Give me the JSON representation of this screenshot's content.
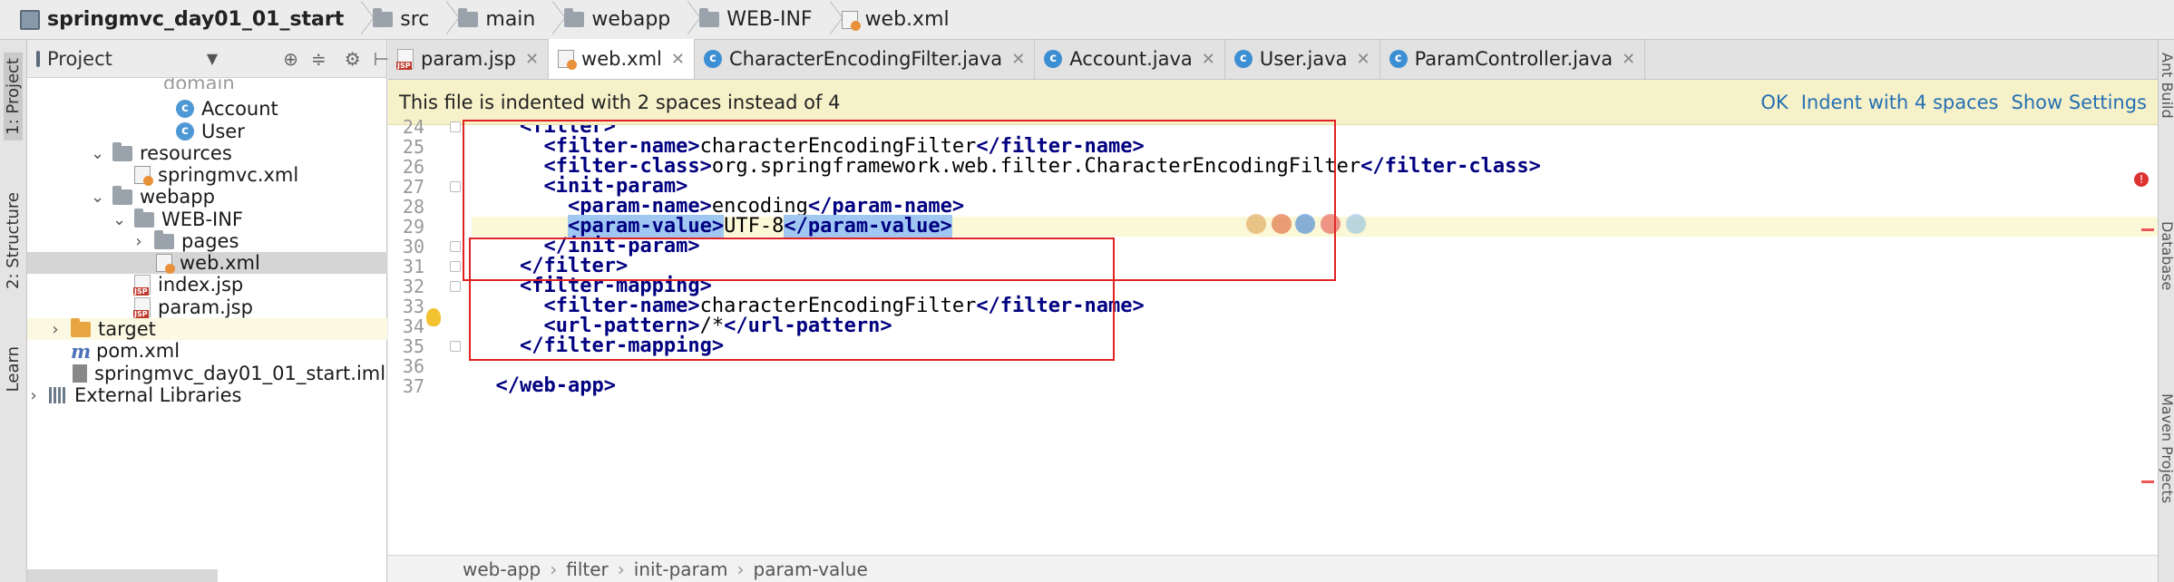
{
  "breadcrumbs": [
    {
      "label": "springmvc_day01_01_start",
      "icon": "module-icon"
    },
    {
      "label": "src",
      "icon": "folder-icon"
    },
    {
      "label": "main",
      "icon": "folder-icon"
    },
    {
      "label": "webapp",
      "icon": "folder-icon"
    },
    {
      "label": "WEB-INF",
      "icon": "folder-icon"
    },
    {
      "label": "web.xml",
      "icon": "xml-file-icon"
    }
  ],
  "left_stripe": {
    "project": "1: Project",
    "structure": "2: Structure",
    "learn": "Learn"
  },
  "project_panel": {
    "title": "Project",
    "tree": [
      {
        "label": "domain",
        "icon": "folder"
      },
      {
        "label": "Account",
        "icon": "class"
      },
      {
        "label": "User",
        "icon": "class"
      },
      {
        "label": "resources",
        "icon": "folder"
      },
      {
        "label": "springmvc.xml",
        "icon": "xml"
      },
      {
        "label": "webapp",
        "icon": "folder"
      },
      {
        "label": "WEB-INF",
        "icon": "folder"
      },
      {
        "label": "pages",
        "icon": "folder"
      },
      {
        "label": "web.xml",
        "icon": "xml"
      },
      {
        "label": "index.jsp",
        "icon": "jsp"
      },
      {
        "label": "param.jsp",
        "icon": "jsp"
      },
      {
        "label": "target",
        "icon": "folder-orange"
      },
      {
        "label": "pom.xml",
        "icon": "maven"
      },
      {
        "label": "springmvc_day01_01_start.iml",
        "icon": "iml"
      },
      {
        "label": "External Libraries",
        "icon": "library"
      }
    ]
  },
  "tabs": [
    {
      "label": "param.jsp",
      "icon": "jsp",
      "active": false
    },
    {
      "label": "web.xml",
      "icon": "xml",
      "active": true
    },
    {
      "label": "CharacterEncodingFilter.java",
      "icon": "class",
      "active": false
    },
    {
      "label": "Account.java",
      "icon": "class",
      "active": false
    },
    {
      "label": "User.java",
      "icon": "class",
      "active": false
    },
    {
      "label": "ParamController.java",
      "icon": "class",
      "active": false
    }
  ],
  "notice": {
    "message": "This file is indented with 2 spaces instead of 4",
    "ok": "OK",
    "indent": "Indent with 4 spaces",
    "settings": "Show Settings"
  },
  "code_lines": [
    {
      "n": "24",
      "indent": "  ",
      "parts": [
        [
          "tag",
          "<filter>"
        ]
      ]
    },
    {
      "n": "25",
      "indent": "    ",
      "parts": [
        [
          "tag",
          "<filter-name>"
        ],
        [
          "txt",
          "characterEncodingFilter"
        ],
        [
          "tag",
          "</filter-name>"
        ]
      ]
    },
    {
      "n": "26",
      "indent": "    ",
      "parts": [
        [
          "tag",
          "<filter-class>"
        ],
        [
          "txt",
          "org.springframework.web.filter.CharacterEncodingFilter"
        ],
        [
          "tag",
          "</filter-class>"
        ]
      ]
    },
    {
      "n": "27",
      "indent": "    ",
      "parts": [
        [
          "tag",
          "<init-param>"
        ]
      ]
    },
    {
      "n": "28",
      "indent": "      ",
      "parts": [
        [
          "tag",
          "<param-name>"
        ],
        [
          "txt",
          "encoding"
        ],
        [
          "tag",
          "</param-name>"
        ]
      ]
    },
    {
      "n": "29",
      "indent": "      ",
      "parts": [
        [
          "tag sel",
          "<param-value>"
        ],
        [
          "txt",
          "UTF-8"
        ],
        [
          "tag sel",
          "</param-value>"
        ]
      ]
    },
    {
      "n": "30",
      "indent": "    ",
      "parts": [
        [
          "tag",
          "</init-param>"
        ]
      ]
    },
    {
      "n": "31",
      "indent": "  ",
      "parts": [
        [
          "tag",
          "</filter>"
        ]
      ]
    },
    {
      "n": "32",
      "indent": "  ",
      "parts": [
        [
          "tag",
          "<filter-mapping>"
        ]
      ]
    },
    {
      "n": "33",
      "indent": "    ",
      "parts": [
        [
          "tag",
          "<filter-name>"
        ],
        [
          "txt",
          "characterEncodingFilter"
        ],
        [
          "tag",
          "</filter-name>"
        ]
      ]
    },
    {
      "n": "34",
      "indent": "    ",
      "parts": [
        [
          "tag",
          "<url-pattern>"
        ],
        [
          "txt",
          "/*"
        ],
        [
          "tag",
          "</url-pattern>"
        ]
      ]
    },
    {
      "n": "35",
      "indent": "  ",
      "parts": [
        [
          "tag",
          "</filter-mapping>"
        ]
      ]
    },
    {
      "n": "36",
      "indent": "",
      "parts": []
    },
    {
      "n": "37",
      "indent": "",
      "parts": [
        [
          "tag",
          "</web-app>"
        ]
      ]
    }
  ],
  "editor_breadcrumbs": [
    "web-app",
    "filter",
    "init-param",
    "param-value"
  ],
  "right_stripe": {
    "ant": "Ant Build",
    "database": "Database",
    "maven": "Maven Projects"
  },
  "colors": {
    "highlight_box": "#e22222",
    "tag": "#000080",
    "notice_bg": "#f6f1c9"
  }
}
